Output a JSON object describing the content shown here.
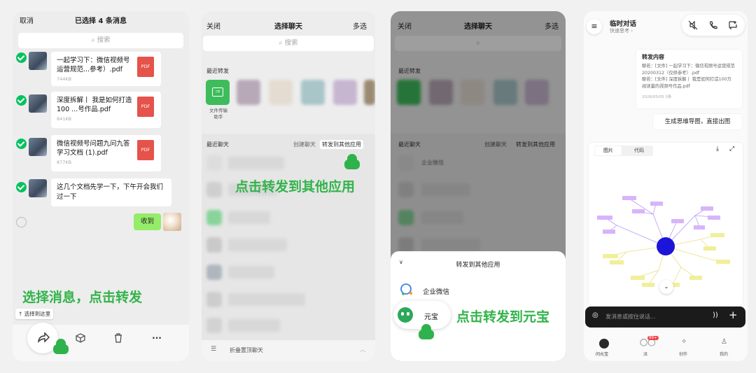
{
  "panel1": {
    "cancel": "取消",
    "title": "已选择 4 条消息",
    "search_placeholder": "搜索",
    "files": [
      {
        "name": "一起学习下：微信视频号运营规范...参考）.pdf",
        "size": "744KB",
        "type": "PDF"
      },
      {
        "name": "深度拆解丨 我是如何打造100 ...号作品.pdf",
        "size": "841KB",
        "type": "PDF"
      },
      {
        "name": "微信视频号问题九问九答学习文档 (1).pdf",
        "size": "877KB",
        "type": "PDF"
      }
    ],
    "text_message": "这几个文档先学一下，下午开会我们过一下",
    "reply": "收到",
    "select_here": "选择到这里",
    "caption": "选择消息，点击转发"
  },
  "panel2": {
    "close": "关闭",
    "title": "选择聊天",
    "multi": "多选",
    "search_placeholder": "搜索",
    "recent_forward": "最近转发",
    "file_helper": "文件传输\n助手",
    "recent_chats": "最近聊天",
    "create_chat": "创建聊天",
    "forward_other": "转发到其他应用",
    "caption": "点击转发到其他应用",
    "fold_pinned": "折叠置顶聊天"
  },
  "panel3": {
    "close": "关闭",
    "title": "选择聊天",
    "multi": "多选",
    "recent_forward": "最近转发",
    "recent_chats": "最近聊天",
    "create_chat": "创建聊天",
    "forward_other": "转发到其他应用",
    "blur_item": "企业微信",
    "sheet_title": "转发到其他应用",
    "apps": [
      "企业微信",
      "元宝"
    ],
    "caption": "点击转发到元宝"
  },
  "panel4": {
    "title": "临时对话",
    "subtitle": "快速思考",
    "forward_title": "转发内容",
    "forward_lines": [
      "聊若：[文件] 一起学习下：微信视频号运营规范20200312（仅供参考）.pdf",
      "聊若：[文件] 深度拆解丨 我是如何打造100万 阅读量的视频号作品.pdf"
    ],
    "forward_meta": "2026/05/05  3条",
    "user_message": "生成思维导图，直接出图",
    "tabs": [
      "图片",
      "代码"
    ],
    "input_placeholder": "发消息或按住说话...",
    "nav": [
      "问元宝",
      "派",
      "创作",
      "我的"
    ],
    "badge": "99+"
  }
}
